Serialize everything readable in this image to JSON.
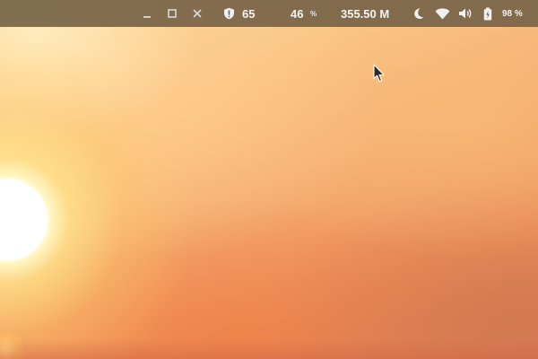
{
  "wallpaper": {
    "description_colors": {
      "sky_top": "#fde0a2",
      "sky_mid": "#f4a86c",
      "sky_bottom": "#d7765a",
      "sun": "#ffffff"
    }
  },
  "top_panel": {
    "background": "#786448",
    "window_controls": {
      "minimize_icon": "minimize-icon",
      "maximize_icon": "maximize-icon",
      "close_icon": "close-icon"
    },
    "indicators": {
      "shield_icon": "shield-icon",
      "shield_value": "65",
      "cpu_value": "46",
      "cpu_unit": "%",
      "network_value": "355.50 M",
      "night_mode_icon": "moon-icon",
      "wifi_icon": "wifi-icon",
      "volume_icon": "volume-icon",
      "battery_icon": "battery-icon",
      "battery_percent": "98 %"
    }
  }
}
